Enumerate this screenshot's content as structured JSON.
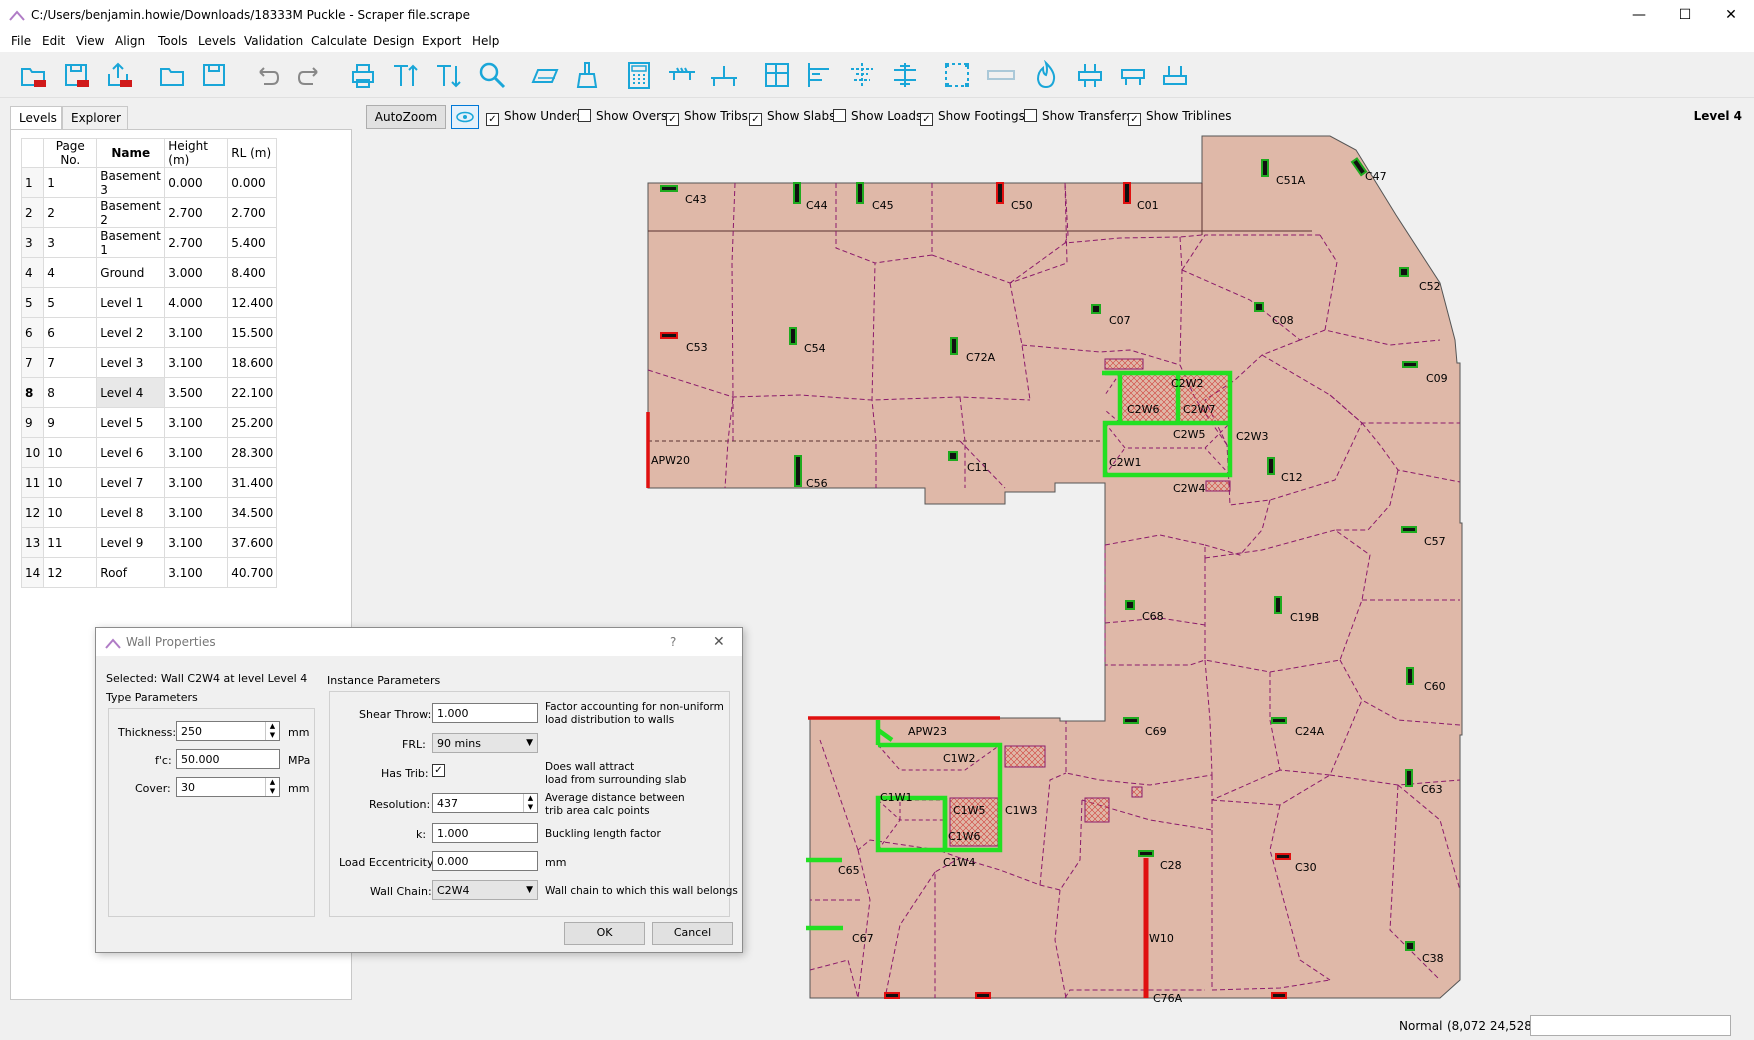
{
  "window": {
    "title": "C:/Users/benjamin.howie/Downloads/18333M Puckle - Scraper file.scrape",
    "minimize": "—",
    "maximize": "☐",
    "close": "✕"
  },
  "menu": [
    "File",
    "Edit",
    "View",
    "Align",
    "Tools",
    "Levels",
    "Validation",
    "Calculate",
    "Design",
    "Export",
    "Help"
  ],
  "tabs": {
    "levels": "Levels",
    "explorer": "Explorer"
  },
  "levels_table": {
    "headers": [
      "Page No.",
      "Name",
      "Height (m)",
      "RL (m)"
    ],
    "rows": [
      {
        "n": "1",
        "page": "1",
        "name": "Basement 3",
        "height": "0.000",
        "rl": "0.000"
      },
      {
        "n": "2",
        "page": "2",
        "name": "Basement 2",
        "height": "2.700",
        "rl": "2.700"
      },
      {
        "n": "3",
        "page": "3",
        "name": "Basement 1",
        "height": "2.700",
        "rl": "5.400"
      },
      {
        "n": "4",
        "page": "4",
        "name": "Ground",
        "height": "3.000",
        "rl": "8.400"
      },
      {
        "n": "5",
        "page": "5",
        "name": "Level 1",
        "height": "4.000",
        "rl": "12.400"
      },
      {
        "n": "6",
        "page": "6",
        "name": "Level 2",
        "height": "3.100",
        "rl": "15.500"
      },
      {
        "n": "7",
        "page": "7",
        "name": "Level 3",
        "height": "3.100",
        "rl": "18.600"
      },
      {
        "n": "8",
        "page": "8",
        "name": "Level 4",
        "height": "3.500",
        "rl": "22.100"
      },
      {
        "n": "9",
        "page": "9",
        "name": "Level 5",
        "height": "3.100",
        "rl": "25.200"
      },
      {
        "n": "10",
        "page": "10",
        "name": "Level 6",
        "height": "3.100",
        "rl": "28.300"
      },
      {
        "n": "11",
        "page": "10",
        "name": "Level 7",
        "height": "3.100",
        "rl": "31.400"
      },
      {
        "n": "12",
        "page": "10",
        "name": "Level 8",
        "height": "3.100",
        "rl": "34.500"
      },
      {
        "n": "13",
        "page": "11",
        "name": "Level 9",
        "height": "3.100",
        "rl": "37.600"
      },
      {
        "n": "14",
        "page": "12",
        "name": "Roof",
        "height": "3.100",
        "rl": "40.700"
      }
    ],
    "selected_row": "8"
  },
  "view_options": {
    "autozoom": "AutoZoom",
    "checks": [
      {
        "label": "Show Unders",
        "checked": true
      },
      {
        "label": "Show Overs",
        "checked": false
      },
      {
        "label": "Show Tribs",
        "checked": true
      },
      {
        "label": "Show Slabs",
        "checked": true
      },
      {
        "label": "Show Loads",
        "checked": false
      },
      {
        "label": "Show Footings",
        "checked": true
      },
      {
        "label": "Show Transfers",
        "checked": false
      },
      {
        "label": "Show Triblines",
        "checked": true
      }
    ],
    "current_level": "Level 4"
  },
  "plan_labels": {
    "columns": [
      "C43",
      "C44",
      "C45",
      "C50",
      "C01",
      "C51A",
      "C47",
      "C52",
      "C53",
      "C54",
      "C72A",
      "C07",
      "C08",
      "C09",
      "APW20",
      "C56",
      "C11",
      "C12",
      "C57",
      "C68",
      "C19B",
      "C60",
      "C69",
      "C24A",
      "C63",
      "C65",
      "C67",
      "C28",
      "C30",
      "W10",
      "C38",
      "C76A",
      "APW23"
    ],
    "core2": [
      "C2W2",
      "C2W6",
      "C2W7",
      "C2W5",
      "C2W3",
      "C2W1",
      "C2W4"
    ],
    "core1": [
      "C1W2",
      "C1W1",
      "C1W5",
      "C1W3",
      "C1W6",
      "C1W4"
    ]
  },
  "dialog": {
    "title": "Wall Properties",
    "help": "?",
    "close": "✕",
    "selected": "Selected: Wall C2W4 at level Level 4",
    "type_params": "Type Parameters",
    "instance_params": "Instance Parameters",
    "thickness": {
      "label": "Thickness:",
      "value": "250",
      "unit": "mm"
    },
    "fc": {
      "label": "f'c:",
      "value": "50.000",
      "unit": "MPa"
    },
    "cover": {
      "label": "Cover:",
      "value": "30",
      "unit": "mm"
    },
    "shear_throw": {
      "label": "Shear Throw:",
      "value": "1.000",
      "desc1": "Factor accounting for non-uniform",
      "desc2": "load distribution to walls"
    },
    "frl": {
      "label": "FRL:",
      "value": "90 mins"
    },
    "has_trib": {
      "label": "Has Trib:",
      "checked": true,
      "desc1": "Does wall attract",
      "desc2": "load from surrounding slab"
    },
    "resolution": {
      "label": "Resolution:",
      "value": "437",
      "desc1": "Average distance between",
      "desc2": "trib area calc points"
    },
    "k": {
      "label": "k:",
      "value": "1.000",
      "desc": "Buckling length factor"
    },
    "load_ecc": {
      "label": "Load Eccentricity:",
      "value": "0.000",
      "unit": "mm"
    },
    "wall_chain": {
      "label": "Wall Chain:",
      "value": "C2W4",
      "desc": "Wall chain to which this wall belongs"
    },
    "ok": "OK",
    "cancel": "Cancel"
  },
  "status": {
    "mode": "Normal",
    "coords": "(8,072  24,528)"
  },
  "colors": {
    "slab": "#dfb8a8",
    "trib_line": "#8b1a6b",
    "core_wall": "#22e022",
    "column_green": "#1faa1f",
    "column_red": "#e01010"
  }
}
